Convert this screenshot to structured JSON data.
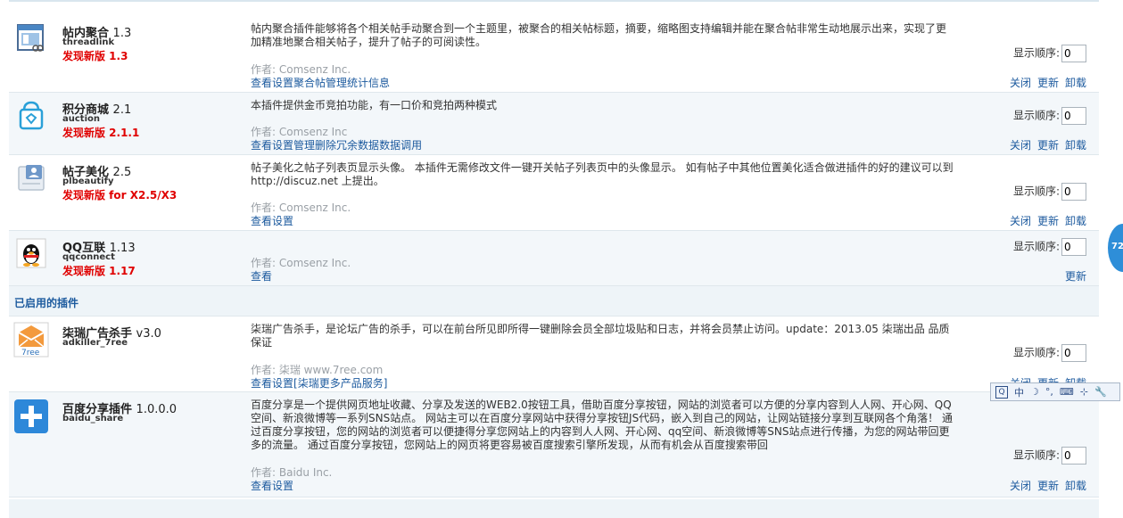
{
  "installed_plugins": [
    {
      "name": "帖内聚合",
      "version": "1.3",
      "identifier": "threadlink",
      "new_version": "发现新版 1.3",
      "description": "帖内聚合插件能够将各个相关帖手动聚合到一个主题里，被聚合的相关帖标题，摘要，缩略图支持编辑并能在聚合帖非常生动地展示出来，实现了更加精准地聚合相关帖子，提升了帖子的可阅读性。",
      "author": "作者: Comsenz Inc.",
      "links": [
        "查看",
        "设置",
        "聚合帖管理",
        "统计信息"
      ],
      "order_label": "显示顺序:",
      "order_value": "0",
      "actions": [
        "关闭",
        "更新",
        "卸载"
      ]
    },
    {
      "name": "积分商城",
      "version": "2.1",
      "identifier": "auction",
      "new_version": "发现新版 2.1.1",
      "description": "本插件提供金币竞拍功能，有一口价和竞拍两种模式",
      "author": "作者: Comsenz Inc",
      "links": [
        "查看",
        "设置",
        "管理",
        "删除冗余数据",
        "数据调用"
      ],
      "order_label": "显示顺序:",
      "order_value": "0",
      "actions": [
        "关闭",
        "更新",
        "卸载"
      ]
    },
    {
      "name": "帖子美化",
      "version": "2.5",
      "identifier": "plbeautify",
      "new_version": "发现新版 for X2.5/X3",
      "description": "帖子美化之帖子列表页显示头像。 本插件无需修改文件一键开关帖子列表页中的头像显示。 如有帖子中其他位置美化适合做进插件的好的建议可以到 http://discuz.net 上提出。",
      "author": "作者: Comsenz Inc.",
      "links": [
        "查看",
        "设置"
      ],
      "order_label": "显示顺序:",
      "order_value": "0",
      "actions": [
        "关闭",
        "更新",
        "卸载"
      ]
    },
    {
      "name": "QQ互联",
      "version": "1.13",
      "identifier": "qqconnect",
      "new_version": "发现新版 1.17",
      "description": "",
      "author": "作者: Comsenz Inc.",
      "links": [
        "查看"
      ],
      "order_label": "显示顺序:",
      "order_value": "0",
      "actions": [
        "更新"
      ]
    }
  ],
  "enabled_section_title": "已启用的插件",
  "enabled_plugins": [
    {
      "name": "柒瑞广告杀手",
      "version": "v3.0",
      "identifier": "adkiller_7ree",
      "icon_text": "7ree",
      "description": "柒瑞广告杀手，是论坛广告的杀手，可以在前台所见即所得一键删除会员全部垃圾贴和日志，并将会员禁止访问。update：2013.05 柒瑞出品 品质保证",
      "author": "作者: 柒瑞 www.7ree.com",
      "links": [
        "查看",
        "设置",
        "[柒瑞更多产品服务]"
      ],
      "order_label": "显示顺序:",
      "order_value": "0",
      "actions": [
        "关闭",
        "更新",
        "卸载"
      ]
    },
    {
      "name": "百度分享插件",
      "version": "1.0.0.0",
      "identifier": "baidu_share",
      "description": "百度分享是一个提供网页地址收藏、分享及发送的WEB2.0按钮工具，借助百度分享按钮，网站的浏览者可以方便的分享内容到人人网、开心网、QQ空间、新浪微博等一系列SNS站点。 网站主可以在百度分享网站中获得分享按钮JS代码，嵌入到自己的网站，让网站链接分享到互联网各个角落！ 通过百度分享按钮，您的网站的浏览者可以便捷得分享您网站上的内容到人人网、开心网、qq空间、新浪微博等SNS站点进行传播，为您的网站带回更多的流量。 通过百度分享按钮，您网站上的网页将更容易被百度搜索引擎所发现，从而有机会从百度搜索带回",
      "author": "作者: Baidu Inc.",
      "links": [
        "查看",
        "设置"
      ],
      "order_label": "显示顺序:",
      "order_value": "0",
      "actions": [
        "关闭",
        "更新",
        "卸载"
      ]
    }
  ],
  "ime_toolbar": {
    "items": [
      "中",
      "☽",
      "°,",
      "⌨",
      "⊹",
      "🔧"
    ]
  },
  "float_badge": "72",
  "colors": {
    "link": "#1c5a9e",
    "new_version": "#e00000",
    "section_bg": "#eef4f8"
  }
}
